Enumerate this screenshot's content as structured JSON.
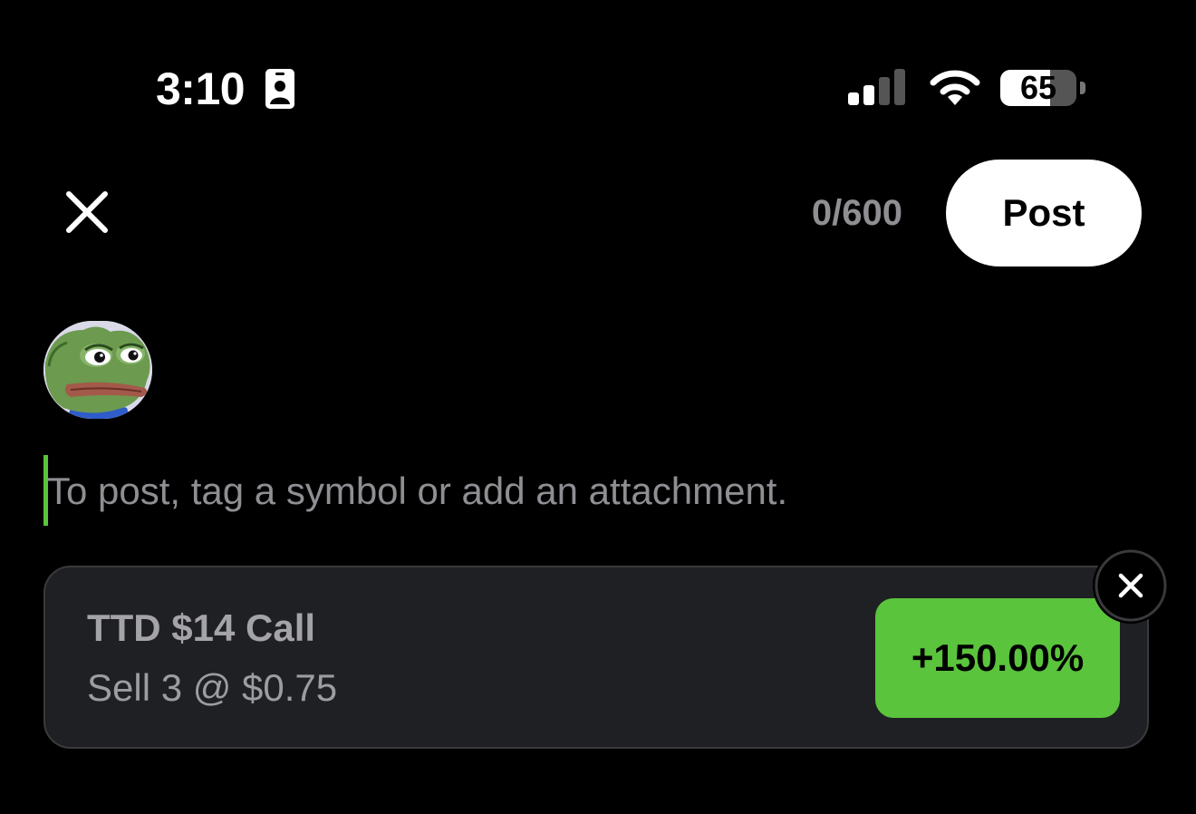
{
  "status_bar": {
    "time": "3:10",
    "battery_level": "65",
    "battery_fraction": 0.65
  },
  "header": {
    "char_count": "0/600",
    "post_label": "Post"
  },
  "composer": {
    "placeholder": "To post, tag a symbol or add an attachment.",
    "value": ""
  },
  "attachment": {
    "title": "TTD $14 Call",
    "subtitle": "Sell 3 @ $0.75",
    "percent_change": "+150.00%"
  },
  "icons": {
    "close": "close-icon",
    "remove_attachment": "close-icon",
    "signal": "cellular-signal-icon",
    "wifi": "wifi-icon",
    "battery": "battery-icon",
    "id_card": "id-card-icon"
  },
  "colors": {
    "background": "#000000",
    "accent_green": "#5ac43c",
    "card_bg": "#1f2023",
    "muted_text": "#8e8e93",
    "post_button_bg": "#ffffff"
  }
}
